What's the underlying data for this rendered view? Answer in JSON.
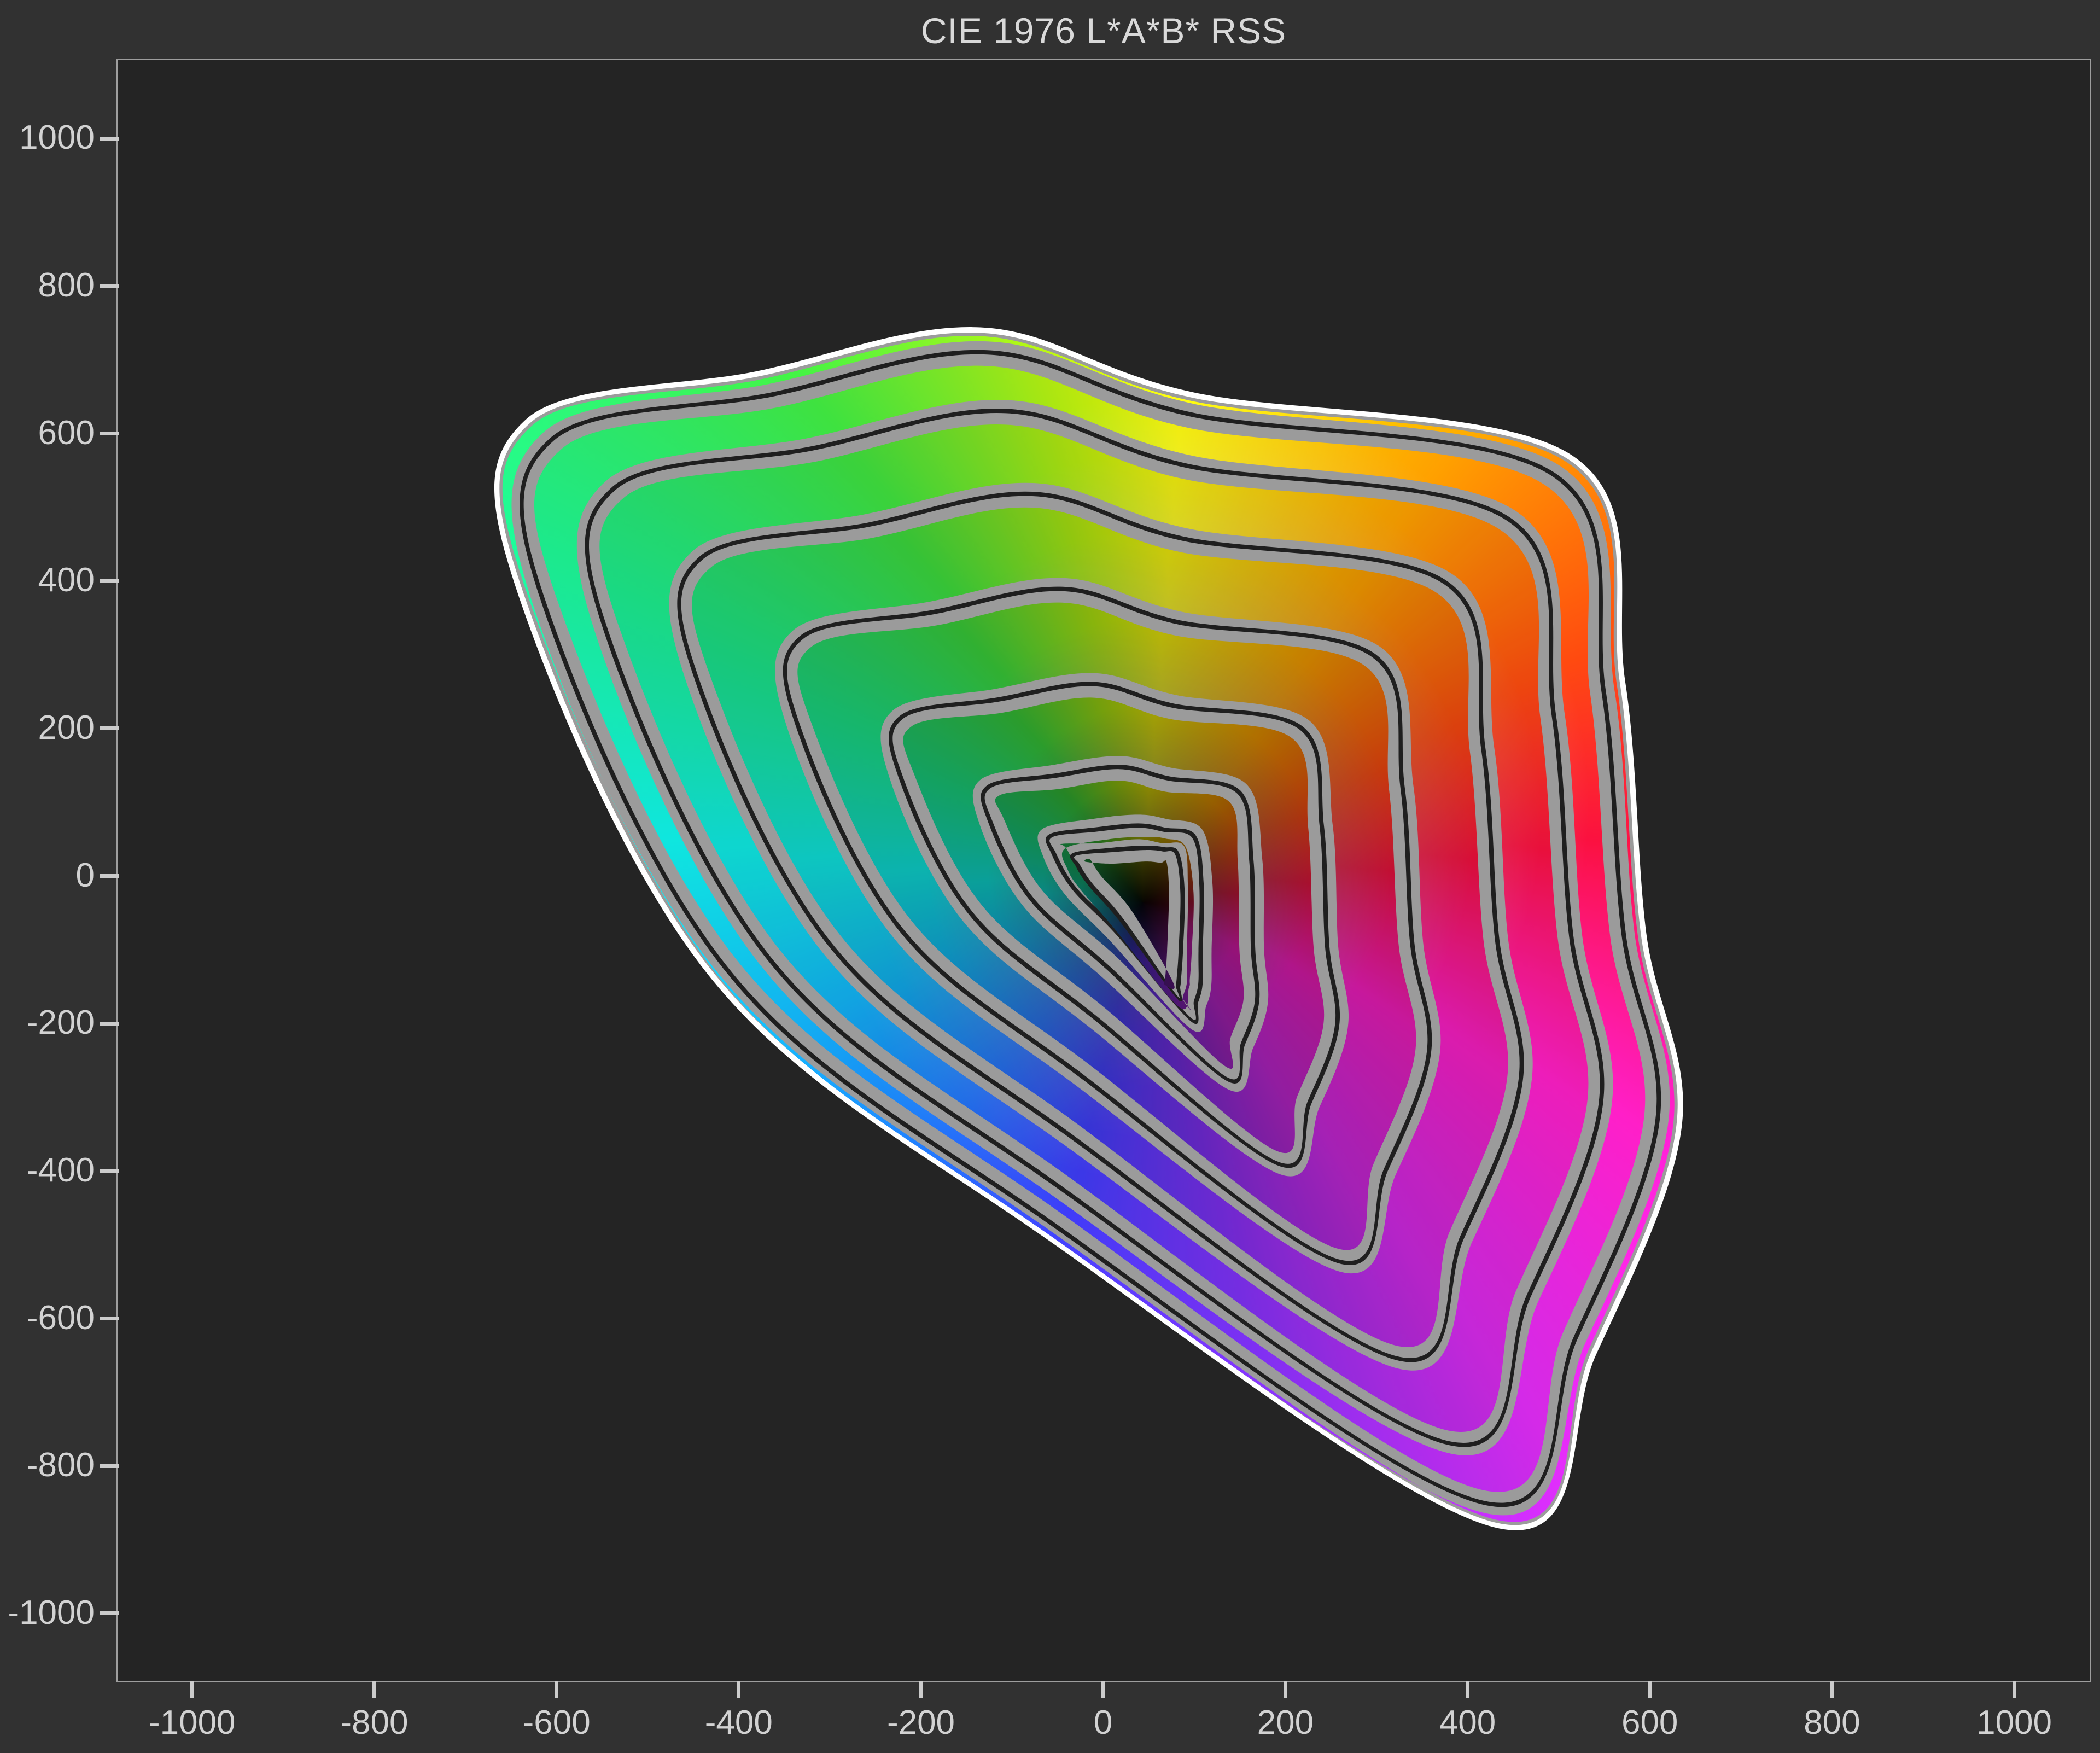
{
  "window": {
    "figure_background": "#313131",
    "plot_background": "#242424",
    "axis_border_color": "#9e9e9e",
    "tick_color": "#cccccc",
    "tick_label_color": "#d2d2d2",
    "title_color": "#d9d9d9"
  },
  "chart_data": {
    "type": "contour",
    "title": "CIE 1976 L*A*B* RSS",
    "xlabel": "",
    "ylabel": "",
    "grid": false,
    "legend": "none",
    "axes": {
      "x": {
        "min": -1080,
        "max": 1081,
        "tick_values": [
          -1000,
          -800,
          -600,
          -400,
          -200,
          0,
          200,
          400,
          600,
          800,
          1000
        ],
        "tick_labels": [
          "-1000",
          "-800",
          "-600",
          "-400",
          "-200",
          "0",
          "200",
          "400",
          "600",
          "800",
          "1000"
        ]
      },
      "y": {
        "min": -1089,
        "max": 1104,
        "tick_values": [
          -1000,
          -800,
          -600,
          -400,
          -200,
          0,
          200,
          400,
          600,
          800,
          1000
        ],
        "tick_labels": [
          "-1000",
          "-800",
          "-600",
          "-400",
          "-200",
          "0",
          "200",
          "400",
          "600",
          "800",
          "1000"
        ]
      }
    },
    "contours": {
      "level_count": 9,
      "outer_envelope_color": "#ffffff",
      "contour_line_color": "#1f1f1f",
      "out_of_raster_gray": "#9b9b9b",
      "outer_shape_ab": [
        [
          -629,
          615
        ],
        [
          -380,
          678
        ],
        [
          -133,
          738
        ],
        [
          100,
          650
        ],
        [
          515,
          565
        ],
        [
          572,
          260
        ],
        [
          595,
          -80
        ],
        [
          634,
          -341
        ],
        [
          540,
          -650
        ],
        [
          435,
          -883
        ],
        [
          -60,
          -490
        ],
        [
          -426,
          -139
        ],
        [
          -640,
          390
        ]
      ],
      "inner_shape_ab": [
        [
          -30,
          27
        ],
        [
          10,
          33
        ],
        [
          48,
          36
        ],
        [
          68,
          34
        ],
        [
          83,
          28
        ],
        [
          89,
          -25
        ],
        [
          87,
          -105
        ],
        [
          85,
          -140
        ],
        [
          84,
          -152
        ],
        [
          82,
          -165
        ],
        [
          22,
          -62
        ],
        [
          -12,
          -14
        ],
        [
          -26,
          12
        ]
      ],
      "level_brightness": [
        1.08,
        1.0,
        0.93,
        0.86,
        0.78,
        0.69,
        0.59,
        0.47,
        0.34
      ],
      "level_center_veil_gray": [
        240,
        220,
        195,
        170,
        145,
        115,
        85,
        50,
        8
      ]
    },
    "hue_wheel_stops": [
      [
        0,
        "#f2ee00"
      ],
      [
        38,
        "#ffa000"
      ],
      [
        70,
        "#ff4a10"
      ],
      [
        95,
        "#fb1140"
      ],
      [
        125,
        "#ff1fc8"
      ],
      [
        150,
        "#d42ae8"
      ],
      [
        172,
        "#7e30f2"
      ],
      [
        195,
        "#3f3cf8"
      ],
      [
        215,
        "#2070fa"
      ],
      [
        240,
        "#12aff2"
      ],
      [
        266,
        "#0fe6df"
      ],
      [
        292,
        "#1ce98c"
      ],
      [
        318,
        "#3fe23f"
      ],
      [
        342,
        "#a9e612"
      ],
      [
        360,
        "#f2ee00"
      ]
    ]
  }
}
